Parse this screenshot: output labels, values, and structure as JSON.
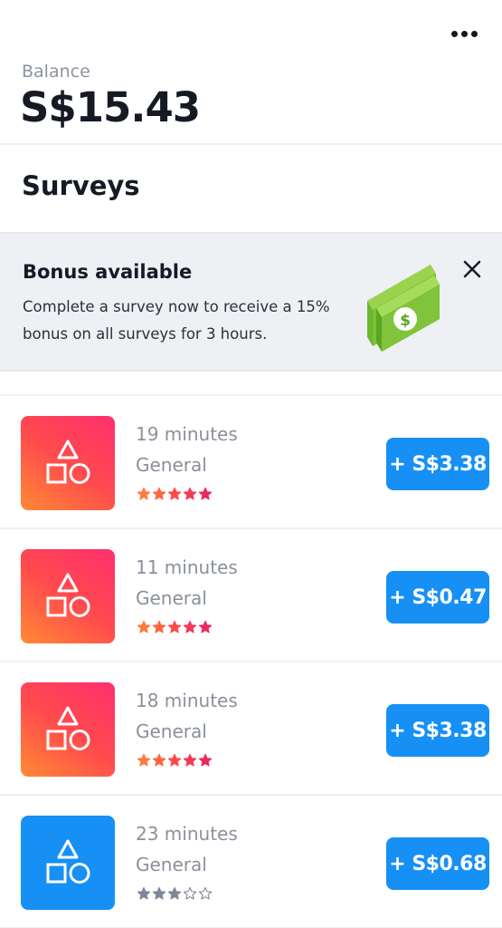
{
  "header": {
    "more_icon": "more-horizontal-icon",
    "balance_label": "Balance",
    "balance_value": "S$15.43"
  },
  "section": {
    "title": "Surveys"
  },
  "bonus": {
    "title": "Bonus available",
    "text": "Complete a survey now to receive a 15% bonus on all surveys for 3 hours.",
    "close_icon": "close-icon",
    "art_icon": "money-bills-icon"
  },
  "surveys": [
    {
      "duration": "19 minutes",
      "category": "General",
      "rating": 5,
      "payout": "+ S$3.38",
      "tile_style": "warm",
      "star_color": "gradient"
    },
    {
      "duration": "11 minutes",
      "category": "General",
      "rating": 5,
      "payout": "+ S$0.47",
      "tile_style": "warm",
      "star_color": "gradient"
    },
    {
      "duration": "18 minutes",
      "category": "General",
      "rating": 5,
      "payout": "+ S$3.38",
      "tile_style": "warm",
      "star_color": "gradient"
    },
    {
      "duration": "23 minutes",
      "category": "General",
      "rating": 3,
      "payout": "+ S$0.68",
      "tile_style": "blue",
      "star_color": "gray"
    }
  ],
  "colors": {
    "accent_blue": "#1690f5",
    "tile_gradient_start": "#ff2f6e",
    "tile_gradient_end": "#ff8a34",
    "star_gray": "#7e8896",
    "bonus_bg": "#eef0f4"
  }
}
